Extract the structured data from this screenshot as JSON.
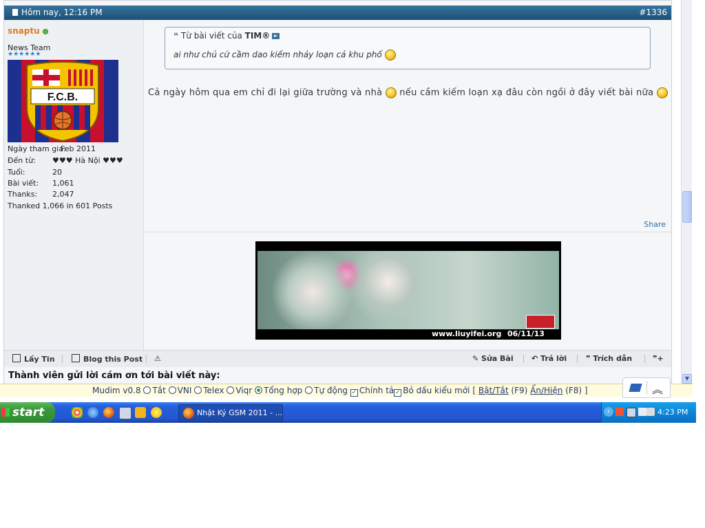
{
  "post": {
    "date": "Hôm nay,  12:16 PM",
    "number": "#1336"
  },
  "user": {
    "name": "snaptu",
    "title": "News Team",
    "stars": "★★★★★★",
    "rows": [
      {
        "label": "Ngày tham gia:",
        "value": "Feb 2011"
      },
      {
        "label": "Đến từ:",
        "value": "♥♥♥ Hà Nội ♥♥♥"
      },
      {
        "label": "Tuổi:",
        "value": "20"
      },
      {
        "label": "Bài viết:",
        "value": "1,061"
      },
      {
        "label": "Thanks:",
        "value": "2,047"
      }
    ],
    "thanked": "Thanked 1,066 in 601 Posts"
  },
  "quote": {
    "prefix": "Từ bài viết của",
    "author": "TIM®",
    "text": "ai như chú cứ cầm dao kiếm nhảy loạn cả khu phố"
  },
  "message": {
    "part1": "Cả ngày hôm qua em chỉ đi lại giữa trường và nhà",
    "part2": " nếu cầm kiếm loạn xạ đâu còn ngồi ở đây viết bài nữa"
  },
  "share_label": "Share",
  "signature": {
    "url": "www.liuyifei.org",
    "date": "06/11/13"
  },
  "actions": {
    "lay_tin": "Lấy Tin",
    "blog_post": "Blog this Post",
    "edit": "Sửa Bài",
    "reply": "Trả lời",
    "quote": "Trích dẫn"
  },
  "thanks_title": "Thành viên gửi lời cám ơn tới bài viết này:",
  "mudim": {
    "version": "Mudim v0.8",
    "opt_off": "Tắt",
    "opt_vni": "VNI",
    "opt_telex": "Telex",
    "opt_viqr": "Viqr",
    "opt_combined": "Tổng hợp",
    "opt_auto": "Tự động",
    "chk_spell": "Chính tả",
    "chk_newstyle": "Bỏ dấu kiểu mới",
    "bracket_open": "[",
    "toggle": "Bật/Tắt",
    "toggle_key": "(F9)",
    "hide": "Ẩn/Hiện",
    "hide_key": "(F8)",
    "bracket_close": "]",
    "selected": "Tổng hợp"
  },
  "taskbar": {
    "start": "start",
    "task_label": "Nhật Ký GSM 2011 - ...",
    "clock": "4:23 PM"
  }
}
